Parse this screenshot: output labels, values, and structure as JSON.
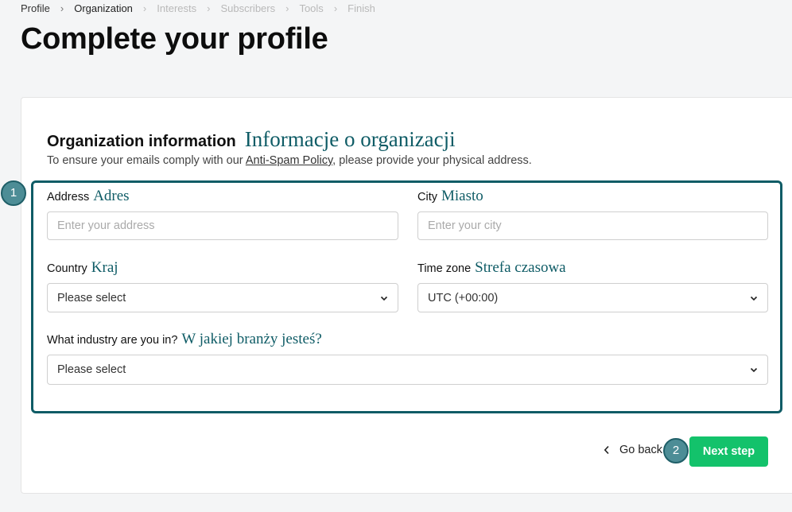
{
  "breadcrumb": {
    "items": [
      "Profile",
      "Organization",
      "Interests",
      "Subscribers",
      "Tools",
      "Finish"
    ]
  },
  "page": {
    "title": "Complete your profile"
  },
  "section": {
    "title": "Organization information",
    "title_translation": "Informacje o organizacji",
    "desc_prefix": "To ensure your emails comply with our ",
    "desc_link": "Anti-Spam Policy",
    "desc_suffix": ", please provide your physical address."
  },
  "markers": {
    "one": "1",
    "two": "2"
  },
  "fields": {
    "address": {
      "label": "Address",
      "translation": "Adres",
      "placeholder": "Enter your address"
    },
    "city": {
      "label": "City",
      "translation": "Miasto",
      "placeholder": "Enter your city"
    },
    "country": {
      "label": "Country",
      "translation": "Kraj",
      "value": "Please select"
    },
    "timezone": {
      "label": "Time zone",
      "translation": "Strefa czasowa",
      "value": "UTC (+00:00)"
    },
    "industry": {
      "label": "What industry are you in?",
      "translation": "W jakiej branży jesteś?",
      "value": "Please select"
    }
  },
  "actions": {
    "back": "Go back",
    "next": "Next step"
  },
  "colors": {
    "accent": "#13c26b",
    "highlight": "#0f5c66"
  }
}
